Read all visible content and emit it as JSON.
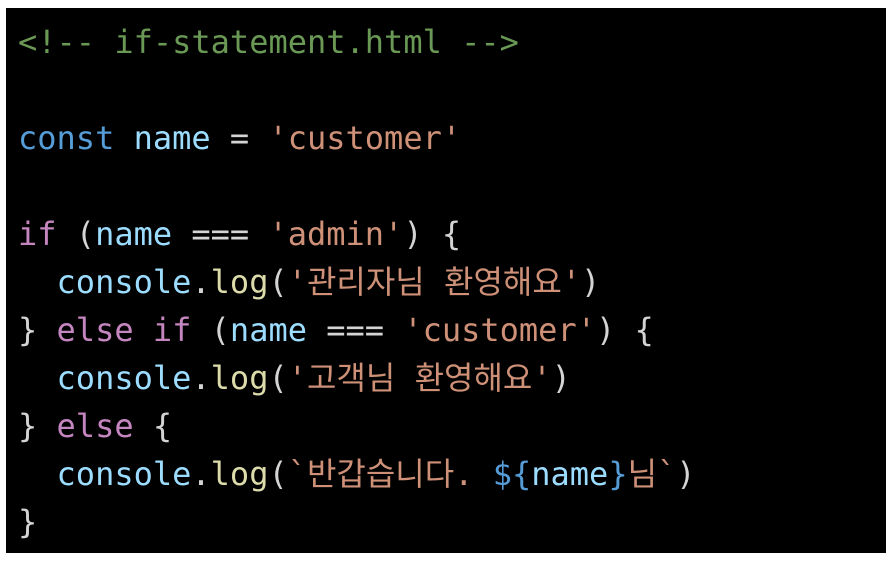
{
  "colors": {
    "background": "#000000",
    "page": "#ffffff",
    "comment": "#6a9955",
    "keyword": "#569cd6",
    "control": "#c586c0",
    "variable": "#9cdcfe",
    "string": "#ce9178",
    "function": "#dcdcaa",
    "plain": "#d4d4d4"
  },
  "code": {
    "lines": [
      [
        {
          "text": "<!-- if-statement.html -->",
          "kind": "comment"
        }
      ],
      [],
      [
        {
          "text": "const",
          "kind": "keyword"
        },
        {
          "text": " ",
          "kind": "plain"
        },
        {
          "text": "name",
          "kind": "variable"
        },
        {
          "text": " = ",
          "kind": "plain"
        },
        {
          "text": "'customer'",
          "kind": "string"
        }
      ],
      [],
      [
        {
          "text": "if",
          "kind": "control"
        },
        {
          "text": " (",
          "kind": "plain"
        },
        {
          "text": "name",
          "kind": "variable"
        },
        {
          "text": " === ",
          "kind": "plain"
        },
        {
          "text": "'admin'",
          "kind": "string"
        },
        {
          "text": ") {",
          "kind": "plain"
        }
      ],
      [
        {
          "text": "  ",
          "kind": "plain"
        },
        {
          "text": "console",
          "kind": "variable"
        },
        {
          "text": ".",
          "kind": "plain"
        },
        {
          "text": "log",
          "kind": "function"
        },
        {
          "text": "(",
          "kind": "plain"
        },
        {
          "text": "'관리자님 환영해요'",
          "kind": "string"
        },
        {
          "text": ")",
          "kind": "plain"
        }
      ],
      [
        {
          "text": "} ",
          "kind": "plain"
        },
        {
          "text": "else",
          "kind": "control"
        },
        {
          "text": " ",
          "kind": "plain"
        },
        {
          "text": "if",
          "kind": "control"
        },
        {
          "text": " (",
          "kind": "plain"
        },
        {
          "text": "name",
          "kind": "variable"
        },
        {
          "text": " === ",
          "kind": "plain"
        },
        {
          "text": "'customer'",
          "kind": "string"
        },
        {
          "text": ") {",
          "kind": "plain"
        }
      ],
      [
        {
          "text": "  ",
          "kind": "plain"
        },
        {
          "text": "console",
          "kind": "variable"
        },
        {
          "text": ".",
          "kind": "plain"
        },
        {
          "text": "log",
          "kind": "function"
        },
        {
          "text": "(",
          "kind": "plain"
        },
        {
          "text": "'고객님 환영해요'",
          "kind": "string"
        },
        {
          "text": ")",
          "kind": "plain"
        }
      ],
      [
        {
          "text": "} ",
          "kind": "plain"
        },
        {
          "text": "else",
          "kind": "control"
        },
        {
          "text": " {",
          "kind": "plain"
        }
      ],
      [
        {
          "text": "  ",
          "kind": "plain"
        },
        {
          "text": "console",
          "kind": "variable"
        },
        {
          "text": ".",
          "kind": "plain"
        },
        {
          "text": "log",
          "kind": "function"
        },
        {
          "text": "(",
          "kind": "plain"
        },
        {
          "text": "`반갑습니다. ",
          "kind": "string"
        },
        {
          "text": "${",
          "kind": "keyword"
        },
        {
          "text": "name",
          "kind": "variable"
        },
        {
          "text": "}",
          "kind": "keyword"
        },
        {
          "text": "님`",
          "kind": "string"
        },
        {
          "text": ")",
          "kind": "plain"
        }
      ],
      [
        {
          "text": "}",
          "kind": "plain"
        }
      ]
    ]
  }
}
